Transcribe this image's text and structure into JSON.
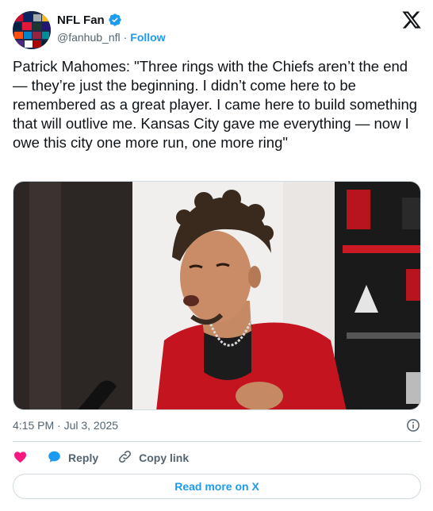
{
  "author": {
    "display_name": "NFL Fan",
    "handle": "@fanhub_nfl",
    "separator": "·",
    "follow_label": "Follow"
  },
  "tweet": {
    "text": "Patrick Mahomes: \"Three rings with the Chiefs aren’t the end — they’re just the beginning. I didn’t come here to be remembered as a great player. I came here to build something that will outlive me. Kansas City gave me everything — now I owe this city one more run, one more ring\"",
    "timestamp": "4:15 PM · Jul 3, 2025"
  },
  "actions": {
    "reply_label": "Reply",
    "copy_link_label": "Copy link",
    "read_more_label": "Read more on X"
  },
  "colors": {
    "accent": "#1d9bf0",
    "like": "#f91880",
    "muted": "#536471",
    "border": "#cfd9de"
  },
  "icons": {
    "verified": "verified-badge-icon",
    "brand": "x-logo-icon",
    "info": "info-icon",
    "like": "heart-icon",
    "reply": "speech-bubble-icon",
    "copy": "link-icon"
  }
}
